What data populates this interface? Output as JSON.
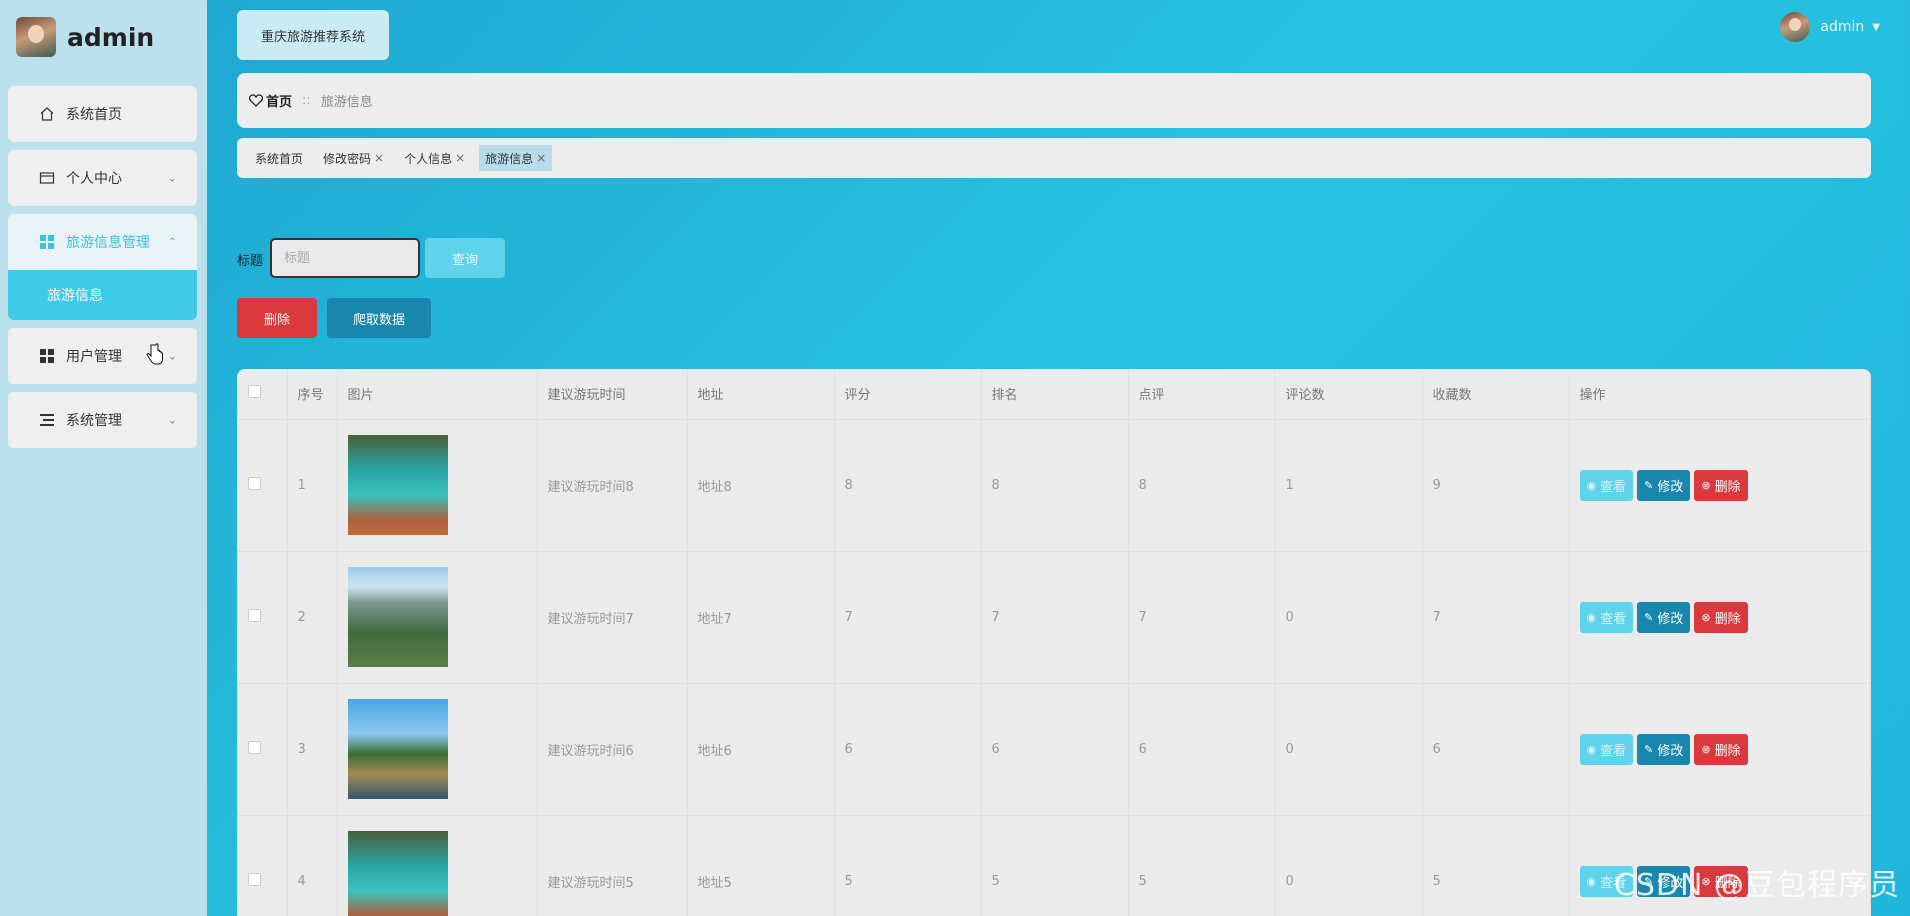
{
  "brand": {
    "name": "admin"
  },
  "sidebar": {
    "items": [
      {
        "label": "系统首页",
        "icon": "home-icon"
      },
      {
        "label": "个人中心",
        "icon": "card-icon"
      },
      {
        "label": "旅游信息管理",
        "icon": "grid-icon"
      },
      {
        "label": "用户管理",
        "icon": "grid-icon"
      },
      {
        "label": "系统管理",
        "icon": "list-icon"
      }
    ],
    "submenu": {
      "label": "旅游信息"
    }
  },
  "header": {
    "system_title": "重庆旅游推荐系统",
    "user_name": "admin",
    "user_caret": "▼"
  },
  "breadcrumb": {
    "home": "首页",
    "separator": "::",
    "current": "旅游信息"
  },
  "tags": [
    {
      "label": "系统首页",
      "closable": false
    },
    {
      "label": "修改密码",
      "closable": true
    },
    {
      "label": "个人信息",
      "closable": true
    },
    {
      "label": "旅游信息",
      "closable": true
    }
  ],
  "search": {
    "label": "标题",
    "placeholder": "标题",
    "query_label": "查询"
  },
  "toolbar": {
    "delete_label": "删除",
    "crawl_label": "爬取数据"
  },
  "table": {
    "headers": [
      "",
      "序号",
      "图片",
      "建议游玩时间",
      "地址",
      "评分",
      "排名",
      "点评",
      "评论数",
      "收藏数",
      "操作"
    ],
    "rows": [
      {
        "index": "1",
        "image": "lake",
        "time": "建议游玩时间8",
        "address": "地址8",
        "score": "8",
        "rank": "8",
        "review": "8",
        "comments": "1",
        "favorites": "9"
      },
      {
        "index": "2",
        "image": "mountain",
        "time": "建议游玩时间7",
        "address": "地址7",
        "score": "7",
        "rank": "7",
        "review": "7",
        "comments": "0",
        "favorites": "7"
      },
      {
        "index": "3",
        "image": "wall",
        "time": "建议游玩时间6",
        "address": "地址6",
        "score": "6",
        "rank": "6",
        "review": "6",
        "comments": "0",
        "favorites": "6"
      },
      {
        "index": "4",
        "image": "lake",
        "time": "建议游玩时间5",
        "address": "地址5",
        "score": "5",
        "rank": "5",
        "review": "5",
        "comments": "0",
        "favorites": "5"
      }
    ],
    "row_actions": {
      "view": "查看",
      "edit": "修改",
      "delete": "删除"
    }
  },
  "watermark": "CSDN @豆包程序员"
}
